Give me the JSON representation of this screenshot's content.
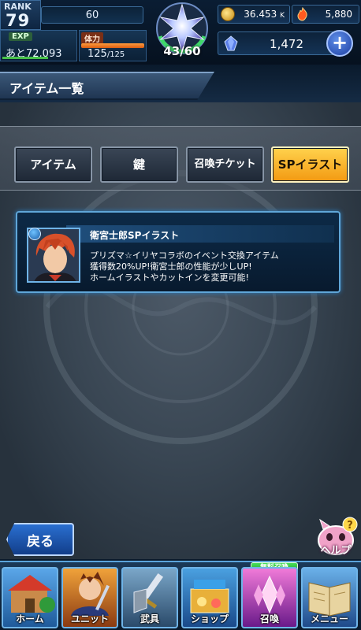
{
  "hud": {
    "rank_label": "RANK",
    "rank_value": "79",
    "rank_bar_value": "60",
    "exp_label": "EXP",
    "exp_value": "あと72,093",
    "stamina_label": "体力",
    "stamina_value": "125",
    "stamina_max": "/125",
    "gem_count": "43/60",
    "coins": "36.453",
    "coins_unit": "K",
    "fire_points": "5,880",
    "stones": "1,472",
    "plus_label": "+"
  },
  "header": {
    "title": "アイテム一覧"
  },
  "tabs": [
    {
      "label": "アイテム"
    },
    {
      "label": "鍵"
    },
    {
      "label": "召喚チケット"
    },
    {
      "label": "SPイラスト"
    }
  ],
  "item": {
    "name": "衛宮士郎SPイラスト",
    "description": [
      "プリズマ☆イリヤコラボのイベント交換アイテム",
      "獲得数20%UP!衛宮士郎の性能が少しUP!",
      "ホームイラストやカットインを変更可能!"
    ]
  },
  "footer": {
    "back_label": "戻る",
    "help_label": "ヘルプ",
    "help_badge": "?",
    "free_summon_tag": "無料召喚"
  },
  "nav": [
    {
      "label": "ホーム",
      "icon": "home-icon"
    },
    {
      "label": "ユニット",
      "icon": "unit-icon"
    },
    {
      "label": "武具",
      "icon": "equipment-icon"
    },
    {
      "label": "ショップ",
      "icon": "shop-icon"
    },
    {
      "label": "召喚",
      "icon": "summon-icon"
    },
    {
      "label": "メニュー",
      "icon": "menu-icon"
    }
  ],
  "colors": {
    "active_tab": "#f39a12",
    "accent_blue": "#5fa6d8"
  }
}
